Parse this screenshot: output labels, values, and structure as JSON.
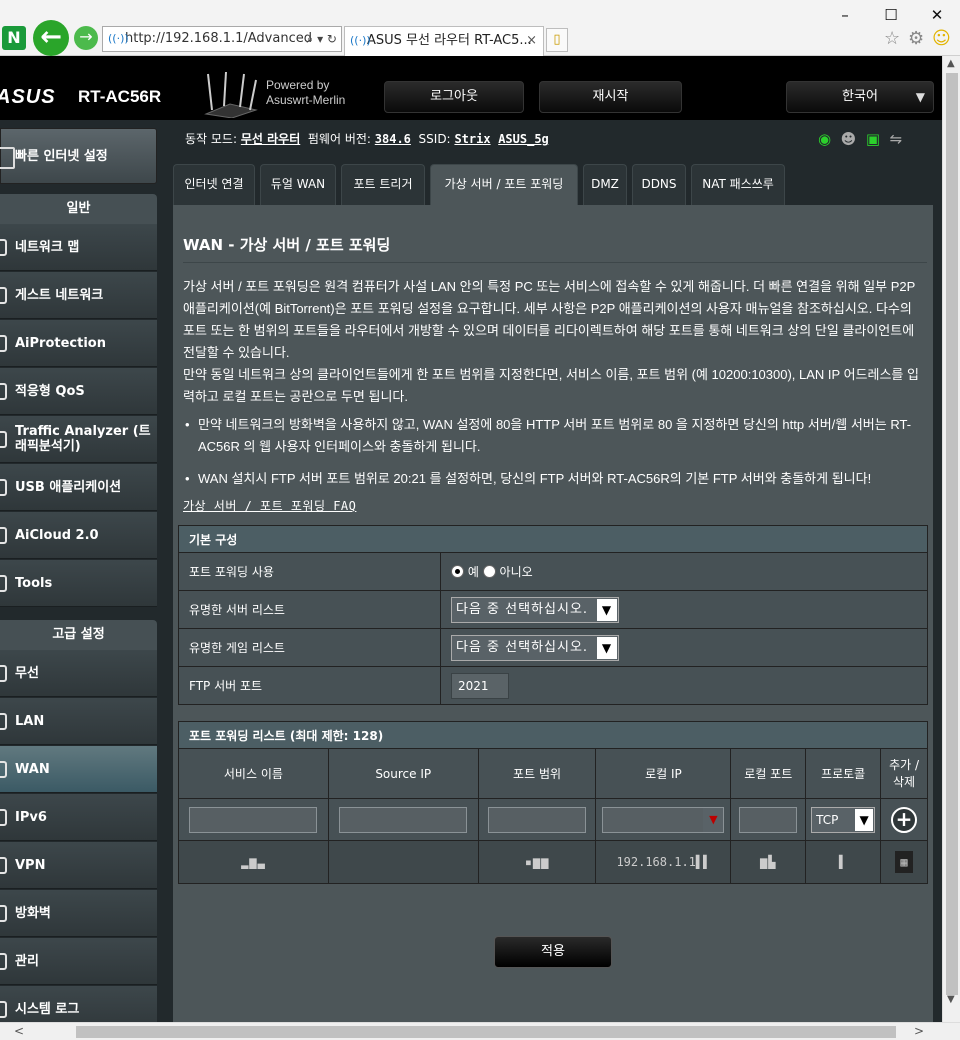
{
  "browser": {
    "logo": "N",
    "address": "http://192.168.1.1/Advanced",
    "tab_title": "ASUS 무선 라우터 RT-AC5...",
    "tab_close": "×",
    "back_glyph": "←",
    "forward_glyph": "→",
    "address_tools": "⌕ ▾ ↻",
    "minimize": "–",
    "maximize": "☐",
    "close": "✕",
    "home_glyph": "☆",
    "settings_glyph": "⚙",
    "smiley_glyph": "☺"
  },
  "header": {
    "brand": "ASUS",
    "model": "RT-AC56R",
    "powered_line1": "Powered by",
    "powered_line2": "Asuswrt-Merlin",
    "logout": "로그아웃",
    "reboot": "재시작",
    "language": "한국어",
    "language_arrow": "▼"
  },
  "status": {
    "mode_label": "동작 모드:",
    "mode_value": "무선 라우터",
    "firmware_label": "펌웨어 버전:",
    "firmware_value": "384.6",
    "ssid_label": "SSID:",
    "ssid_1": "Strix",
    "ssid_2": "ASUS_5g",
    "icons": [
      "wifi-icon",
      "users-icon",
      "network-icon",
      "usb-icon"
    ]
  },
  "sidebar": {
    "quick_setup": "빠른 인터넷 설정",
    "general_header": "일반",
    "general_items": [
      {
        "label": "네트워크 맵"
      },
      {
        "label": "게스트 네트워크"
      },
      {
        "label": "AiProtection"
      },
      {
        "label": "적응형 QoS"
      },
      {
        "label": "Traffic Analyzer (트래픽분석기)"
      },
      {
        "label": "USB 애플리케이션"
      },
      {
        "label": "AiCloud 2.0"
      },
      {
        "label": "Tools"
      }
    ],
    "advanced_header": "고급 설정",
    "advanced_items": [
      {
        "label": "무선"
      },
      {
        "label": "LAN"
      },
      {
        "label": "WAN",
        "active": true
      },
      {
        "label": "IPv6"
      },
      {
        "label": "VPN"
      },
      {
        "label": "방화벽"
      },
      {
        "label": "관리"
      },
      {
        "label": "시스템 로그"
      }
    ]
  },
  "tabs": [
    {
      "label": "인터넷 연결"
    },
    {
      "label": "듀얼 WAN"
    },
    {
      "label": "포트 트리거"
    },
    {
      "label": "가상 서버 / 포트 포워딩",
      "active": true
    },
    {
      "label": "DMZ"
    },
    {
      "label": "DDNS"
    },
    {
      "label": "NAT 패스쓰루"
    }
  ],
  "panel": {
    "title": "WAN - 가상 서버 / 포트 포워딩",
    "description_1": "가상 서버 / 포트 포워딩은 원격 컴퓨터가 사설 LAN 안의 특정 PC 또는 서비스에 접속할 수 있게 해줍니다. 더 빠른 연결을 위해 일부 P2P 애플리케이션(예 BitTorrent)은 포트 포워딩 설정을 요구합니다. 세부 사항은 P2P 애플리케이션의 사용자 매뉴얼을 참조하십시오. 다수의 포트 또는 한 범위의 포트들을 라우터에서 개방할 수 있으며 데이터를 리다이렉트하여 해당 포트를 통해 네트워크 상의 단일 클라이언트에 전달할 수 있습니다.",
    "description_2": "만약 동일 네트워크 상의 클라이언트들에게 한 포트 범위를 지정한다면, 서비스 이름, 포트 범위 (예 10200:10300), LAN IP 어드레스를 입력하고 로컬 포트는 공란으로 두면 됩니다.",
    "bullet_1": "만약 네트워크의 방화벽을 사용하지 않고, WAN 설정에 80을 HTTP 서버 포트 범위로 80 을 지정하면 당신의 http 서버/웹 서버는 RT-AC56R 의 웹 사용자 인터페이스와 충돌하게 됩니다.",
    "bullet_2": "WAN 설치시 FTP 서버 포트 범위로 20:21 를 설정하면, 당신의 FTP 서버와 RT-AC56R의 기본 FTP 서버와 충돌하게 됩니다!",
    "faq_link": "가상 서버 / 포트 포워딩 FAQ"
  },
  "basic_config": {
    "header": "기본 구성",
    "rows": {
      "enable_label": "포트 포워딩 사용",
      "enable_yes": "예",
      "enable_no": "아니오",
      "enable_value": "예",
      "server_list_label": "유명한 서버 리스트",
      "server_list_value": "다음 중 선택하십시오.",
      "game_list_label": "유명한 게임 리스트",
      "game_list_value": "다음 중 선택하십시오.",
      "ftp_port_label": "FTP 서버 포트",
      "ftp_port_value": "2021"
    }
  },
  "pf_list": {
    "header": "포트 포워딩 리스트 (최대 제한: 128)",
    "columns": [
      "서비스 이름",
      "Source IP",
      "포트 범위",
      "로컬 IP",
      "로컬 포트",
      "프로토콜",
      "추가 / 삭제"
    ],
    "input_row": {
      "protocol": "TCP",
      "add_glyph": "+",
      "select_arrow": "▼"
    },
    "rows": [
      {
        "service": "▂▆▃",
        "source_ip": "",
        "port_range": "▪▆▆",
        "local_ip": "192.168.1.1▌▌",
        "local_port": "▆▙",
        "protocol": "▌",
        "delete_glyph": "▦"
      }
    ]
  },
  "apply_button": "적용",
  "scrollbars": {
    "up": "▲",
    "down": "▼",
    "left": "<",
    "right": ">"
  }
}
